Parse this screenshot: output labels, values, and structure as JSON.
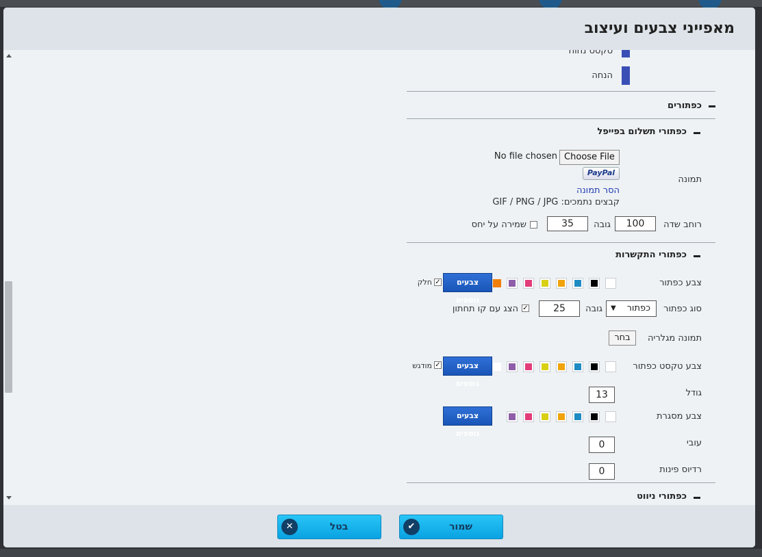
{
  "modal": {
    "title": "מאפייני צבעים ועיצוב"
  },
  "top_rows": [
    {
      "label": "טקסט נחוח",
      "color": "#3a4fb5"
    },
    {
      "label": "הנחה",
      "color": "#3a4fb5"
    }
  ],
  "sections": {
    "buttons": {
      "title": "כפתורים"
    },
    "paypal": {
      "title": "כפתורי תשלום בפייפל",
      "image_label": "תמונה",
      "no_file": "No file chosen",
      "choose_file": "Choose File",
      "paypal_badge": "PayPal",
      "remove_image": "הסר תמונה",
      "supported": "קבצים נתמכים: GIF / PNG / JPG",
      "width_label": "רוחב שדה",
      "width_value": "100",
      "height_label": "גובה",
      "height_value": "35",
      "keep_ratio": "שמירה על יחס"
    },
    "link_buttons": {
      "title": "כפתורי התקשרות",
      "button_color_label": "צבע כפתור",
      "more_colors": "צבעים נוספים",
      "smooth": "חלק",
      "button_type_label": "סוג כפתור",
      "button_type_value": "כפתור",
      "height_label": "גובה",
      "height_value": "25",
      "underline": "הצג עם קו תחתון",
      "gallery_label": "תמונה מגלריה",
      "choose": "בחר",
      "text_color_label": "צבע טקסט כפתור",
      "bold": "מודגש",
      "size_label": "גודל",
      "size_value": "13",
      "border_color_label": "צבע מסגרת",
      "thickness_label": "עובי",
      "thickness_value": "0",
      "radius_label": "רדיוס פינות",
      "radius_value": "0"
    },
    "nav_buttons": {
      "title": "כפתורי ניווט"
    }
  },
  "palette": [
    "#ffffff",
    "#000000",
    "#1e8bc3",
    "#f0a30a",
    "#d9d016",
    "#e23d7a",
    "#8e5ea8"
  ],
  "palette_extra": "#ffffff",
  "palette_orange": "#f07f0a",
  "footer": {
    "save": "שמור",
    "cancel": "בטל"
  }
}
